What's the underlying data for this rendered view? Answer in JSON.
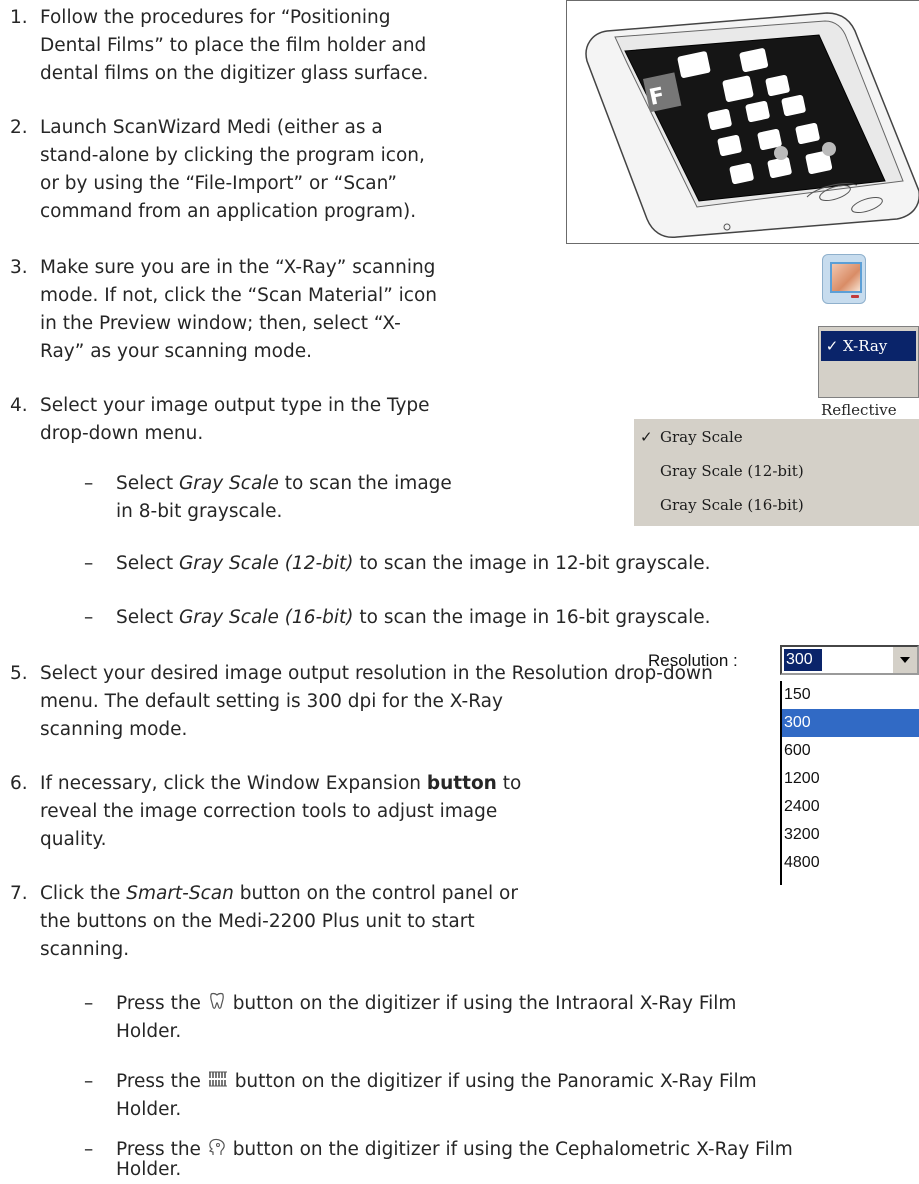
{
  "steps": [
    {
      "number": "1.",
      "lines": [
        "Follow the procedures for “Positioning",
        "Dental Films” to place the film holder and",
        "dental films on the digitizer glass surface."
      ]
    },
    {
      "number": "2.",
      "lines": [
        "Launch ScanWizard Medi (either as a",
        "stand-alone by clicking the program icon,",
        "or by using the “File-Import” or “Scan”",
        "command from an application program)."
      ]
    },
    {
      "number": "3.",
      "lines": [
        "Make sure you are in the “X-Ray” scanning",
        "mode. If not, click the “Scan Material” icon",
        "in the Preview window; then, select “X-",
        "Ray” as your scanning mode."
      ]
    },
    {
      "number": "4.",
      "lines": [
        "Select your image output type in the Type",
        "drop-down menu."
      ]
    },
    {
      "number": "5.",
      "lines": [
        "Select your desired image output resolution in the Resolution drop-down",
        "menu. The default setting is 300 dpi for the X-Ray",
        "scanning mode."
      ]
    },
    {
      "number": "6.",
      "line1_pre": "If necessary, click the Window Expansion ",
      "line1_bold": "button",
      "line1_post": " to",
      "lines": [
        "reveal the image correction tools to adjust image",
        "quality."
      ]
    },
    {
      "number": "7.",
      "line1_pre": "Click the ",
      "line1_italic": "Smart-Scan",
      "line1_post": " button on the control panel or",
      "lines": [
        "the buttons on the Medi-2200 Plus unit to start",
        "scanning."
      ]
    }
  ],
  "type_bullets": [
    {
      "dash": "–",
      "pre": "Select ",
      "italic": "Gray Scale",
      "post": " to scan the image",
      "line2": "in 8-bit grayscale."
    },
    {
      "dash": "–",
      "pre": "Select ",
      "italic": "Gray Scale (12-bit)",
      "post": " to scan the image in 12-bit grayscale."
    },
    {
      "dash": "–",
      "pre": "Select ",
      "italic": "Gray Scale (16-bit)",
      "post": " to scan the image in 16-bit grayscale."
    }
  ],
  "button_bullets": [
    {
      "dash": "–",
      "pre": "Press the ",
      "icon": "tooth-icon",
      "post": " button on the digitizer if using the Intraoral X-Ray Film",
      "line2": "Holder."
    },
    {
      "dash": "–",
      "pre": "Press the ",
      "icon": "teeth-row-icon",
      "post": " button on the digitizer if using the Panoramic X-Ray Film",
      "line2": "Holder."
    },
    {
      "dash": "–",
      "pre": "Press the ",
      "icon": "head-profile-icon",
      "post": " button on the digitizer if using the Cephalometric X-Ray Film",
      "line2": "Holder."
    }
  ],
  "scan_material_menu": {
    "icon": "scan-material-icon",
    "items": [
      {
        "label": "X-Ray",
        "checked": true
      },
      {
        "label": "Reflective",
        "checked": false
      }
    ]
  },
  "type_menu": {
    "items": [
      {
        "label": "Gray Scale",
        "checked": true
      },
      {
        "label": "Gray Scale (12-bit)",
        "checked": false
      },
      {
        "label": "Gray Scale (16-bit)",
        "checked": false
      }
    ]
  },
  "resolution": {
    "label": "Resolution :",
    "value": "300",
    "options": [
      "150",
      "300",
      "600",
      "1200",
      "2400",
      "3200",
      "4800"
    ],
    "selected": "300"
  },
  "scanner_image": {
    "icon": "scanner-with-films-icon",
    "film_letter": "F"
  },
  "colors": {
    "text": "#262626",
    "menu_bg": "#d4d0c8",
    "selection": "#0a246a",
    "list_selection": "#316ac5"
  }
}
